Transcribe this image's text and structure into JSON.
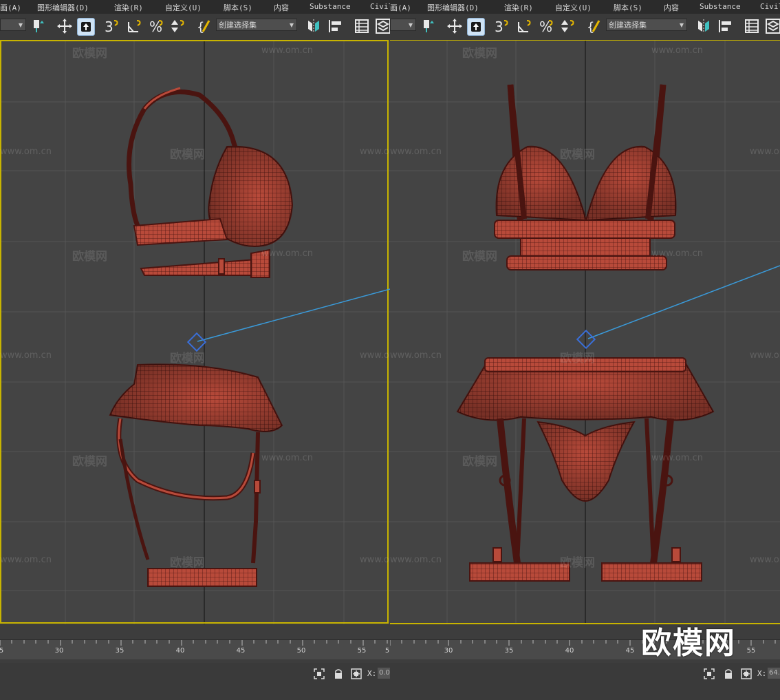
{
  "menubar": {
    "items": [
      "画(A)",
      "图形编辑器(D)",
      "渲染(R)",
      "自定义(U)",
      "脚本(S)",
      "内容",
      "Substance",
      "Civil"
    ]
  },
  "toolbar": {
    "selection_set_placeholder": "创建选择集",
    "layer_dropdown": ""
  },
  "viewports": {
    "left": {
      "name": "left-viewport"
    },
    "right": {
      "name": "right-viewport"
    }
  },
  "timeline": {
    "left_ticks": [
      "5",
      "30",
      "35",
      "40",
      "45",
      "50",
      "55",
      "5"
    ],
    "right_ticks": [
      "30",
      "35",
      "40",
      "45",
      "50",
      "55"
    ]
  },
  "status": {
    "x_label": "X:",
    "x_value_left": "0.0",
    "x_value_right": "64."
  },
  "watermark": {
    "brand": "欧模网",
    "url": "www.om.cn",
    "stamp": "欧模网"
  },
  "colors": {
    "viewport_bg": "#444444",
    "grid": "#555555",
    "border_active": "#c8b400",
    "mesh": "#b84a3a",
    "wire": "#4a1410",
    "link": "#3a9ad9"
  }
}
